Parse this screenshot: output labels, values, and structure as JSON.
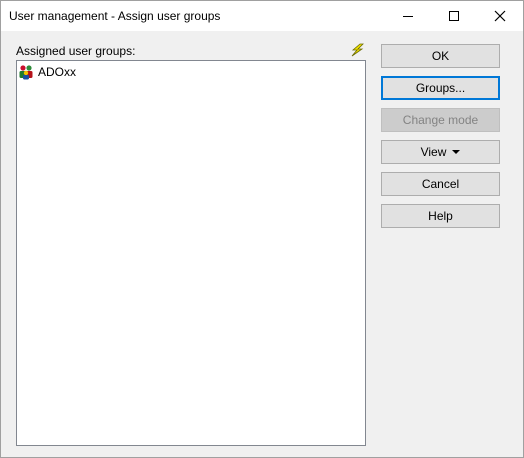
{
  "window": {
    "title": "User management - Assign user groups"
  },
  "main": {
    "list_label": "Assigned user groups:",
    "groups": [
      {
        "name": "ADOxx",
        "icon": "user-group-icon"
      }
    ]
  },
  "buttons": {
    "ok": "OK",
    "groups": "Groups...",
    "change_mode": "Change mode",
    "view": "View",
    "cancel": "Cancel",
    "help": "Help"
  },
  "colors": {
    "focus_border": "#0078d7",
    "button_face": "#e1e1e1",
    "disabled_text": "#838383"
  }
}
